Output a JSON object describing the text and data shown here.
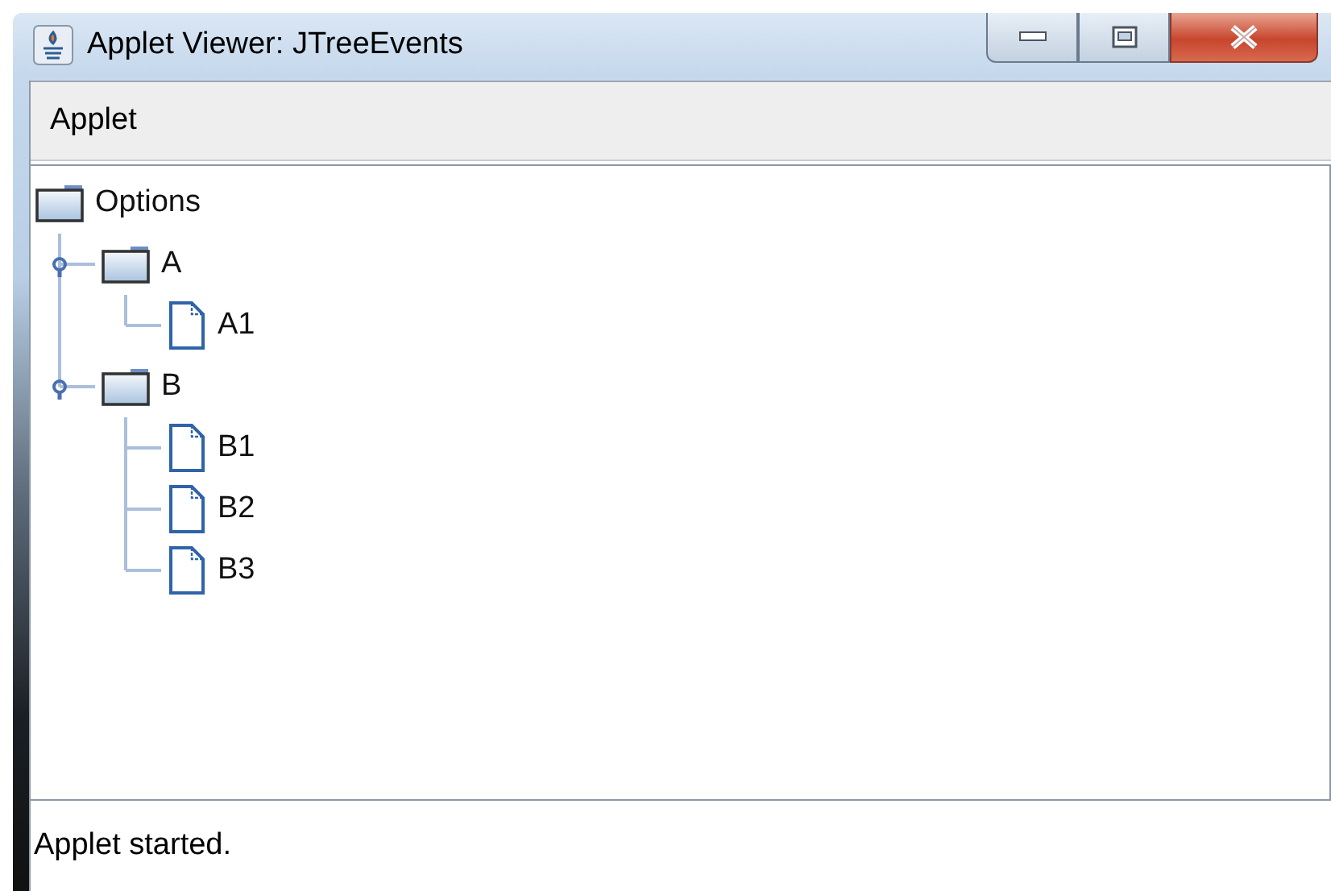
{
  "window": {
    "title": "Applet Viewer: JTreeEvents"
  },
  "menu_bar": {
    "items": [
      "Applet"
    ]
  },
  "tree": {
    "root": {
      "label": "Options",
      "kind": "folder",
      "children": [
        {
          "label": "A",
          "kind": "folder",
          "expanded": true,
          "children": [
            {
              "label": "A1",
              "kind": "leaf"
            }
          ]
        },
        {
          "label": "B",
          "kind": "folder",
          "expanded": true,
          "children": [
            {
              "label": "B1",
              "kind": "leaf"
            },
            {
              "label": "B2",
              "kind": "leaf"
            },
            {
              "label": "B3",
              "kind": "leaf"
            }
          ]
        }
      ]
    }
  },
  "status_bar": {
    "text": "Applet started."
  }
}
